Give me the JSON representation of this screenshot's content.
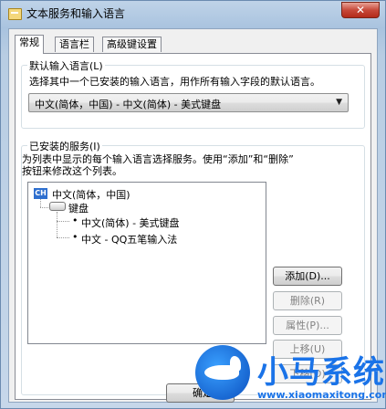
{
  "window": {
    "title": "文本服务和输入语言",
    "close_glyph": "✕"
  },
  "tabs": [
    {
      "label": "常规",
      "active": true
    },
    {
      "label": "语言栏",
      "active": false
    },
    {
      "label": "高级键设置",
      "active": false
    }
  ],
  "default_language": {
    "group_label": "默认输入语言(L)",
    "description": "选择其中一个已安装的输入语言，用作所有输入字段的默认语言。",
    "selected": "中文(简体，中国) - 中文(简体) - 美式键盘"
  },
  "installed_services": {
    "group_label": "已安装的服务(I)",
    "description_line1": "为列表中显示的每个输入语言选择服务。使用“添加”和“删除”",
    "description_line2": "按钮来修改这个列表。",
    "tree": {
      "language": "中文(简体，中国)",
      "language_badge": "CH",
      "category": "键盘",
      "items": [
        "中文(简体) - 美式键盘",
        "中文 - QQ五笔输入法"
      ]
    },
    "buttons": {
      "add": "添加(D)...",
      "remove": "删除(R)",
      "properties": "属性(P)...",
      "move_up": "上移(U)",
      "move_down": "下移(O)"
    }
  },
  "footer": {
    "ok": "确定"
  },
  "watermark": {
    "name": "小马系统",
    "url": "www.xiaomaxitong.com"
  }
}
